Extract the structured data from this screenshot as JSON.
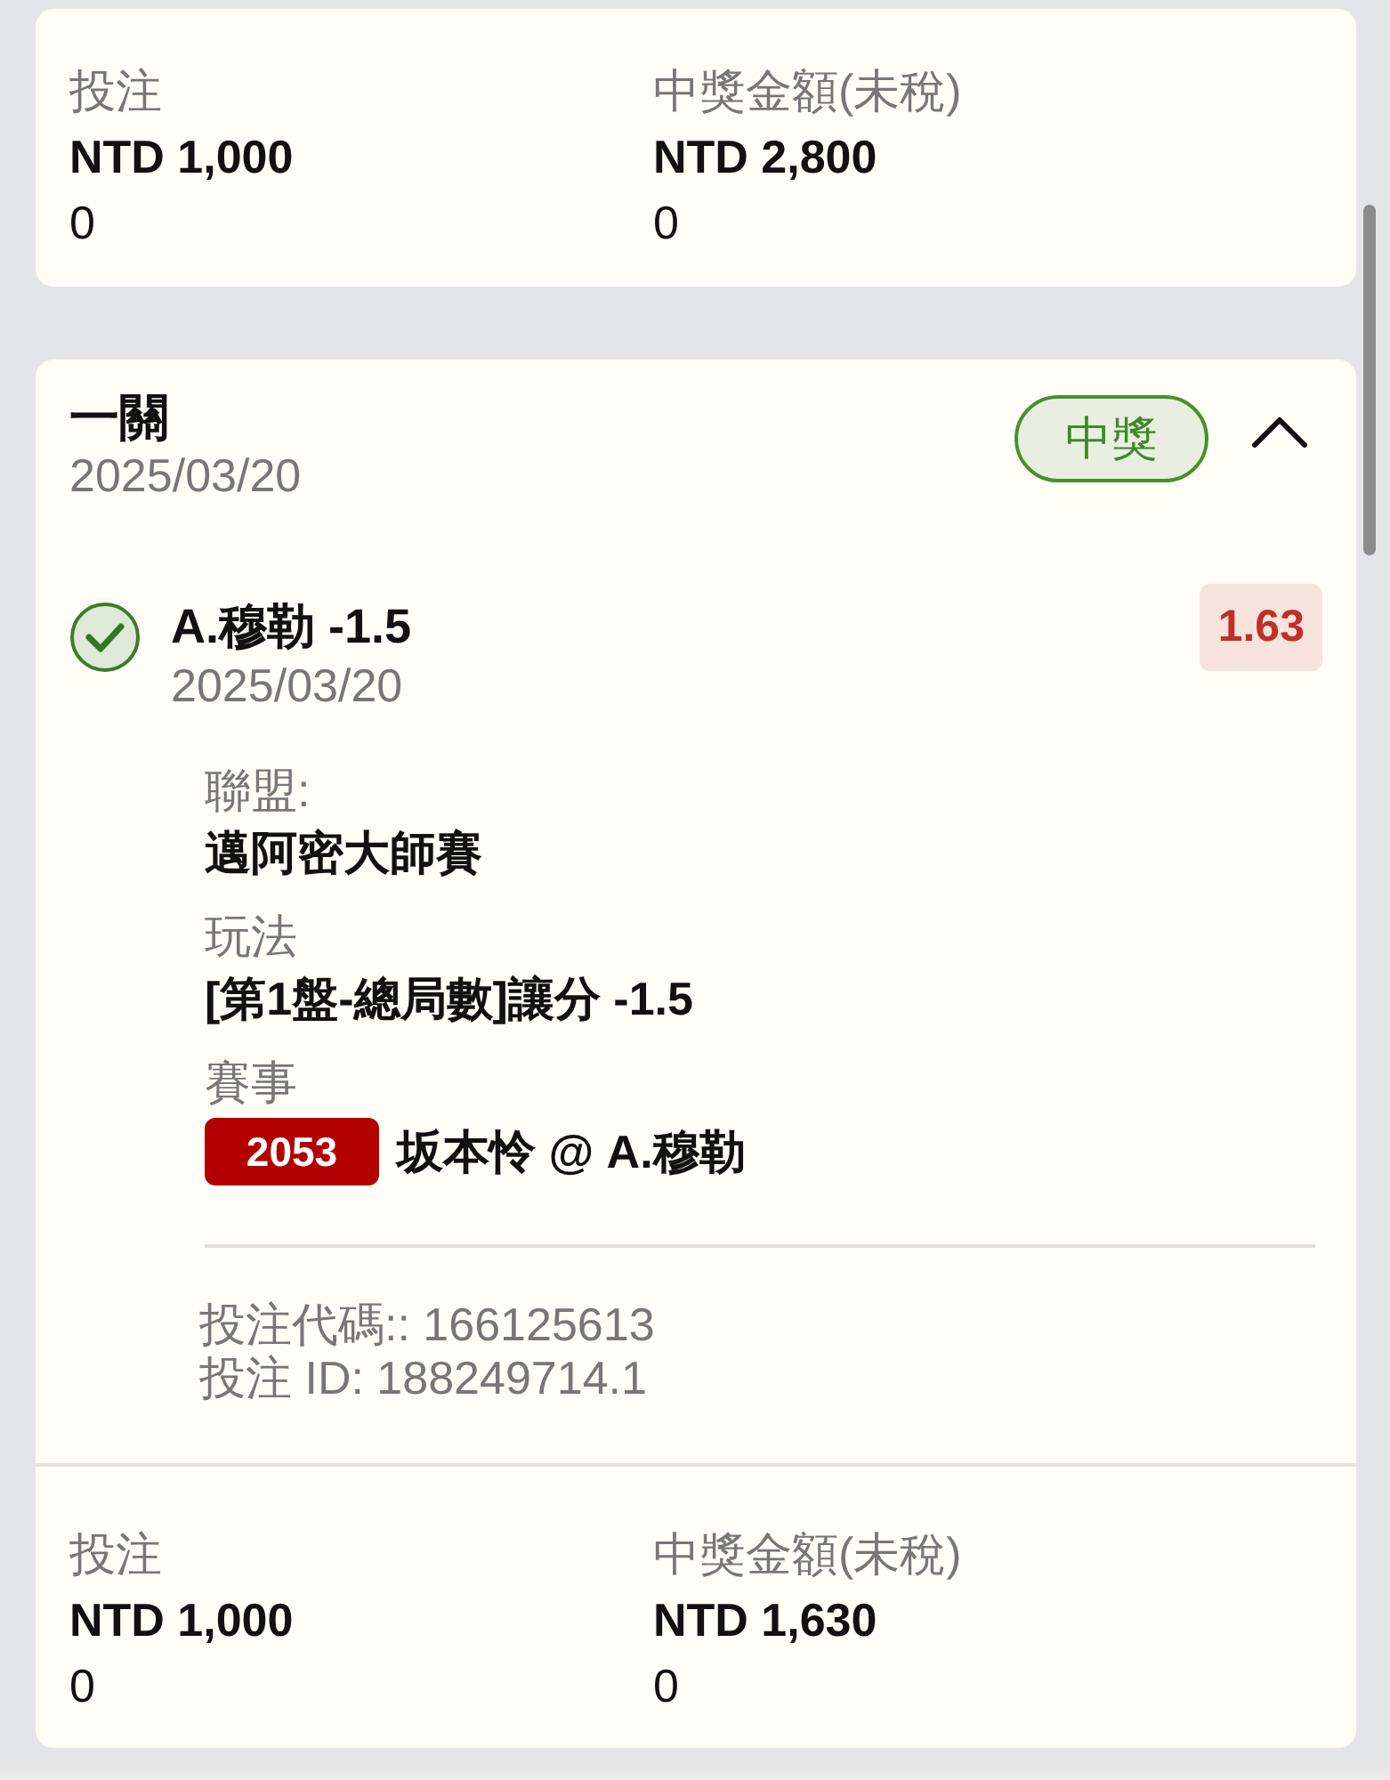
{
  "summary": {
    "totals": [
      {
        "label": "投注",
        "amount": "NTD 1,000",
        "extra": "0"
      },
      {
        "label": "中獎金額(未稅)",
        "amount": "NTD 2,800",
        "extra": "0"
      }
    ]
  },
  "bet": {
    "title": "一關",
    "date": "2025/03/20",
    "status": {
      "label": "中獎",
      "kind": "won"
    },
    "expanded": true,
    "selections": [
      {
        "won": true,
        "pick": "A.穆勒 -1.5",
        "date": "2025/03/20",
        "odds": "1.63",
        "details": [
          {
            "label": "聯盟:",
            "value": "邁阿密大師賽"
          },
          {
            "label": "玩法",
            "value": "[第1盤-總局數]讓分 -1.5"
          },
          {
            "label": "賽事",
            "code": "2053",
            "value": "坂本怜 @ A.穆勒"
          }
        ],
        "bet_code": "投注代碼:: 166125613",
        "bet_id": "投注 ID: 188249714.1"
      }
    ],
    "totals": [
      {
        "label": "投注",
        "amount": "NTD 1,000",
        "extra": "0"
      },
      {
        "label": "中獎金額(未稅)",
        "amount": "NTD 1,630",
        "extra": "0"
      }
    ]
  }
}
